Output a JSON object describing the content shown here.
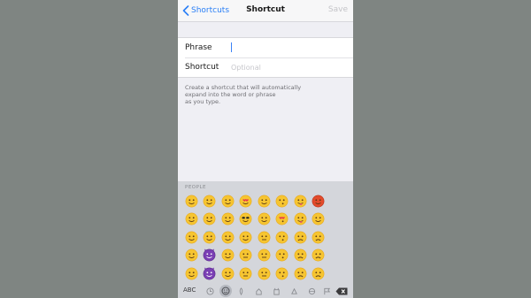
{
  "nav": {
    "back_label": "Shortcuts",
    "title": "Shortcut",
    "save_label": "Save"
  },
  "form": {
    "phrase_label": "Phrase",
    "phrase_value": "",
    "shortcut_label": "Shortcut",
    "shortcut_placeholder": "Optional"
  },
  "helper_text": "Create a shortcut that will automatically\n expand into the word or phrase\n as you type.",
  "keyboard": {
    "section_label": "PEOPLE",
    "abc_label": "ABC",
    "emoji_rows": [
      [
        "grinning-face",
        "grinning-sweat-face",
        "blushing-face",
        "heart-eyes-face",
        "relieved-face",
        "kissing-face",
        "tongue-wink-face",
        "angry-red-face"
      ],
      [
        "laughing-face",
        "squinting-face",
        "smiling-face",
        "sunglasses-face",
        "sweat-face",
        "kiss-heart-face",
        "tongue-face",
        "crying-face"
      ],
      [
        "tears-of-joy-face",
        "halo-face",
        "smirking-face",
        "smirk-face",
        "unamused-face",
        "kissing-closed-face",
        "disappointed-face",
        "tired-face"
      ],
      [
        "big-grin-face",
        "imp-purple",
        "yum-face",
        "expressionless-face",
        "neutral-face",
        "kissing-smile-face",
        "confused-face",
        "triumph-face"
      ],
      [
        "grin-face",
        "smiling-imp-purple",
        "relaxed-face",
        "neutral-face-2",
        "pensive-face",
        "kissing-face-2",
        "worried-face",
        "persevering-face"
      ]
    ],
    "category_icons": [
      "recent-icon",
      "people-icon",
      "nature-icon",
      "objects-icon",
      "places-icon",
      "symbols-icon",
      "flags-icon",
      "travel-icon",
      "extra-icon"
    ],
    "delete_icon": "backspace-icon"
  },
  "colors": {
    "accent": "#2a7ff6",
    "face": "#f6c531",
    "face_dark": "#e9a817",
    "angry": "#e34b2b",
    "imp": "#7a3fb4",
    "heart": "#e8364a"
  }
}
